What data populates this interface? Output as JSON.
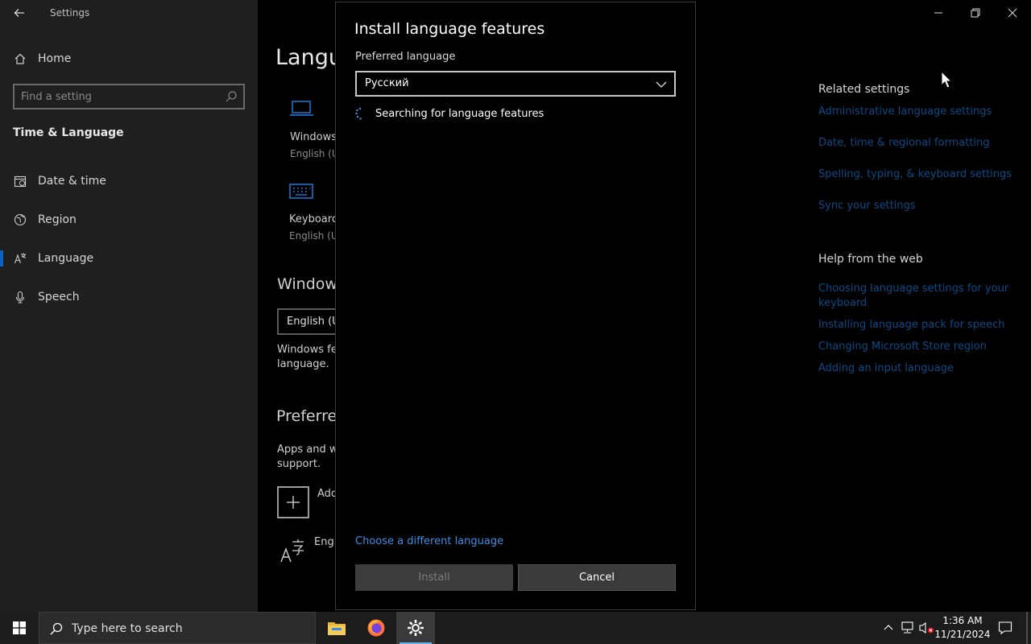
{
  "window": {
    "title": "Settings"
  },
  "sidebar": {
    "home_label": "Home",
    "search_placeholder": "Find a setting",
    "section_title": "Time & Language",
    "items": [
      {
        "label": "Date & time",
        "icon": "calendar-icon"
      },
      {
        "label": "Region",
        "icon": "globe-icon"
      },
      {
        "label": "Language",
        "icon": "language-icon",
        "active": true
      },
      {
        "label": "Speech",
        "icon": "microphone-icon"
      }
    ]
  },
  "main": {
    "page_title_partial": "Langu",
    "windows_display_label": "Windows",
    "windows_display_sub": "English (U",
    "keyboard_label": "Keyboard",
    "keyboard_sub": "English (U",
    "windows_display_heading": "Window",
    "windows_display_select": "English (U",
    "windows_desc_line1": "Windows fe",
    "windows_desc_line2": "language.",
    "preferred_heading": "Preferre",
    "preferred_desc_line1": "Apps and w",
    "preferred_desc_line2": "support.",
    "add_label": "Add",
    "lang_item": "Engl"
  },
  "right_panel": {
    "related_heading": "Related settings",
    "related_links": [
      "Administrative language settings",
      "Date, time & regional formatting",
      "Spelling, typing, & keyboard settings",
      "Sync your settings"
    ],
    "help_heading": "Help from the web",
    "help_links": [
      "Choosing language settings for your keyboard",
      "Installing language pack for speech",
      "Changing Microsoft Store region",
      "Adding an input language"
    ]
  },
  "dialog": {
    "title": "Install language features",
    "preferred_label": "Preferred language",
    "selected_language": "Русский",
    "status": "Searching for language features",
    "different_language_link": "Choose a different language",
    "install_label": "Install",
    "cancel_label": "Cancel"
  },
  "taskbar": {
    "search_placeholder": "Type here to search",
    "time": "1:36 AM",
    "date": "11/21/2024"
  },
  "colors": {
    "accent": "#0b63c2",
    "link_dim": "#0b4a86",
    "link": "#3f8ee0"
  }
}
